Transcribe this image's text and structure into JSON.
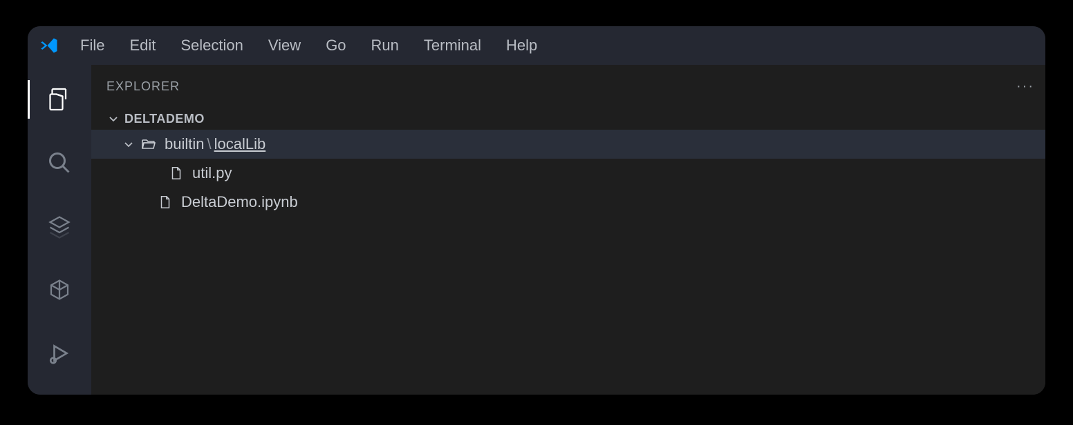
{
  "menubar": {
    "items": [
      "File",
      "Edit",
      "Selection",
      "View",
      "Go",
      "Run",
      "Terminal",
      "Help"
    ]
  },
  "sidebar": {
    "title": "EXPLORER",
    "project": "DELTADEMO",
    "folder_part1": "builtin",
    "folder_sep": "\\",
    "folder_part2": "localLib",
    "file1": "util.py",
    "file2": "DeltaDemo.ipynb"
  }
}
